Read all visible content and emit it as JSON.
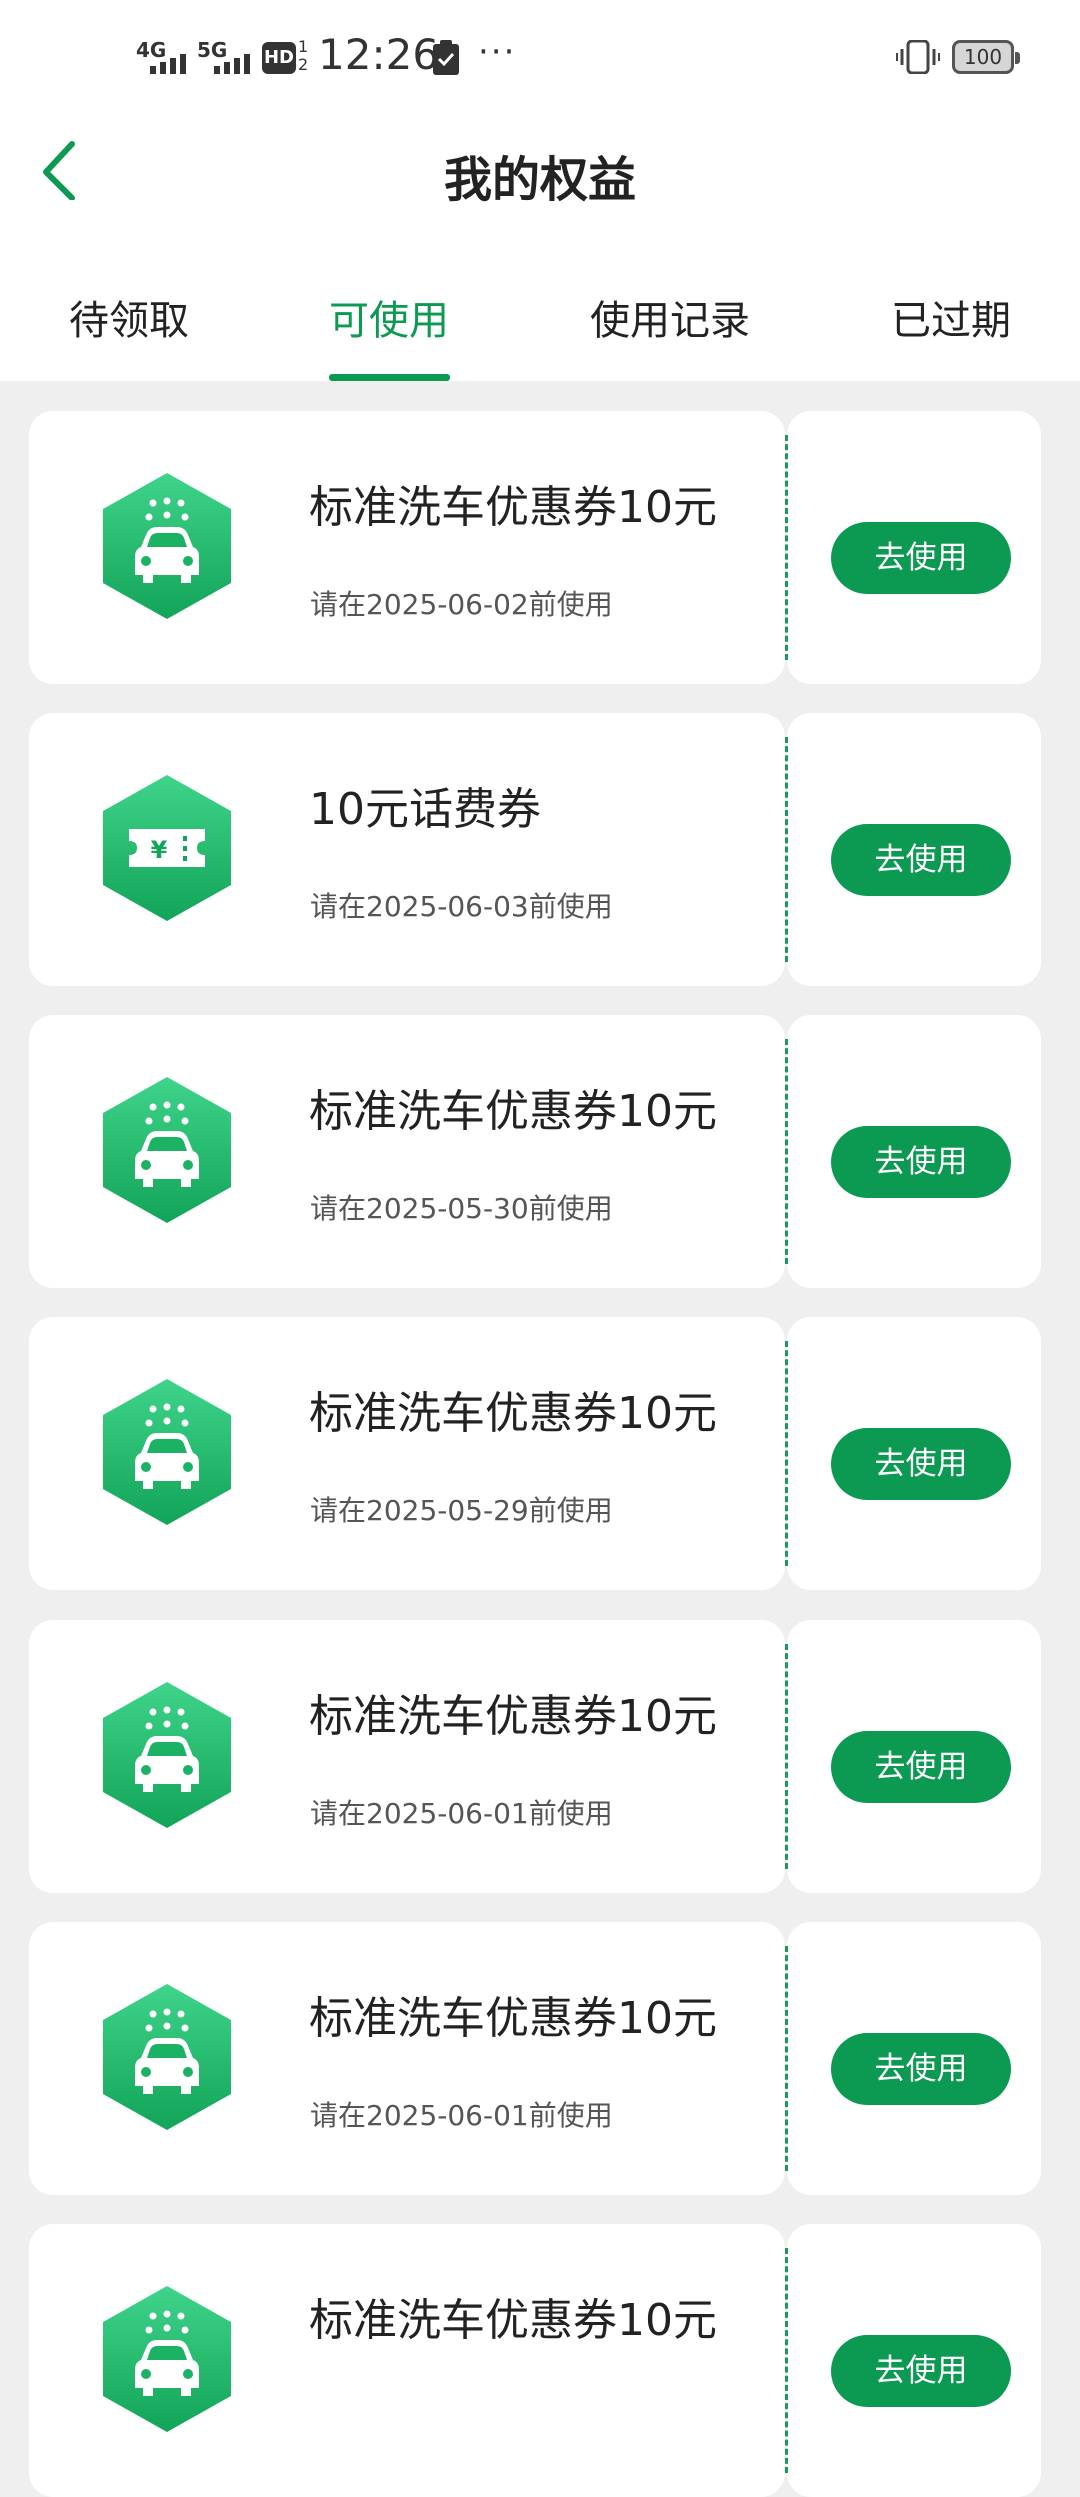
{
  "status_bar": {
    "network1": "4G",
    "network2": "5G",
    "hd_label": "HD",
    "sim_fraction": "1\n2",
    "time": "12:26",
    "more": "···",
    "battery": "100"
  },
  "header": {
    "title": "我的权益"
  },
  "tabs": [
    {
      "label": "待领取"
    },
    {
      "label": "可使用"
    },
    {
      "label": "使用记录"
    },
    {
      "label": "已过期"
    }
  ],
  "active_tab": "可使用",
  "coupons": [
    {
      "title": "标准洗车优惠券10元",
      "expiry": "请在2025-06-02前使用",
      "button": "去使用",
      "icon": "car-wash-icon"
    },
    {
      "title": "10元话费券",
      "expiry": "请在2025-06-03前使用",
      "button": "去使用",
      "icon": "phone-bill-ticket-icon"
    },
    {
      "title": "标准洗车优惠券10元",
      "expiry": "请在2025-05-30前使用",
      "button": "去使用",
      "icon": "car-wash-icon"
    },
    {
      "title": "标准洗车优惠券10元",
      "expiry": "请在2025-05-29前使用",
      "button": "去使用",
      "icon": "car-wash-icon"
    },
    {
      "title": "标准洗车优惠券10元",
      "expiry": "请在2025-06-01前使用",
      "button": "去使用",
      "icon": "car-wash-icon"
    },
    {
      "title": "标准洗车优惠券10元",
      "expiry": "请在2025-06-01前使用",
      "button": "去使用",
      "icon": "car-wash-icon"
    },
    {
      "title": "标准洗车优惠券10元",
      "expiry": "",
      "button": "去使用",
      "icon": "car-wash-icon"
    }
  ],
  "colors": {
    "accent": "#0c9a52",
    "background": "#efefef"
  }
}
